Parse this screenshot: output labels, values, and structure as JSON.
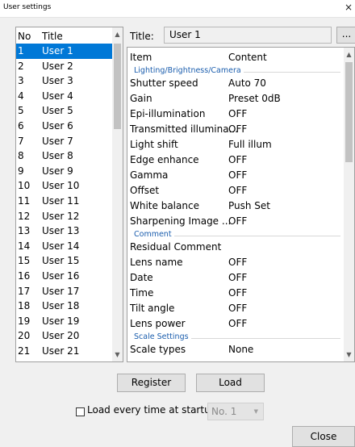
{
  "window": {
    "title": "User settings",
    "close_glyph": "×"
  },
  "list": {
    "col_no": "No",
    "col_title": "Title",
    "selected_index": 0,
    "items": [
      {
        "no": "1",
        "name": "User 1"
      },
      {
        "no": "2",
        "name": "User 2"
      },
      {
        "no": "3",
        "name": "User 3"
      },
      {
        "no": "4",
        "name": "User 4"
      },
      {
        "no": "5",
        "name": "User 5"
      },
      {
        "no": "6",
        "name": "User 6"
      },
      {
        "no": "7",
        "name": "User 7"
      },
      {
        "no": "8",
        "name": "User 8"
      },
      {
        "no": "9",
        "name": "User 9"
      },
      {
        "no": "10",
        "name": "User 10"
      },
      {
        "no": "11",
        "name": "User 11"
      },
      {
        "no": "12",
        "name": "User 12"
      },
      {
        "no": "13",
        "name": "User 13"
      },
      {
        "no": "14",
        "name": "User 14"
      },
      {
        "no": "15",
        "name": "User 15"
      },
      {
        "no": "16",
        "name": "User 16"
      },
      {
        "no": "17",
        "name": "User 17"
      },
      {
        "no": "18",
        "name": "User 18"
      },
      {
        "no": "19",
        "name": "User 19"
      },
      {
        "no": "20",
        "name": "User 20"
      },
      {
        "no": "21",
        "name": "User 21"
      }
    ]
  },
  "title_field": {
    "label": "Title:",
    "value": "User 1",
    "browse_label": "..."
  },
  "settings": {
    "col_item": "Item",
    "col_content": "Content",
    "rows": [
      {
        "group": "Lighting/Brightness/Camera"
      },
      {
        "item": "Shutter speed",
        "content": "Auto 70"
      },
      {
        "item": "Gain",
        "content": "Preset 0dB"
      },
      {
        "item": "Epi-illumination",
        "content": "OFF"
      },
      {
        "item": "Transmitted illumina...",
        "content": "OFF"
      },
      {
        "item": "Light shift",
        "content": "Full illum"
      },
      {
        "item": "Edge enhance",
        "content": "OFF"
      },
      {
        "item": "Gamma",
        "content": "OFF"
      },
      {
        "item": "Offset",
        "content": "OFF"
      },
      {
        "item": "White balance",
        "content": "Push Set"
      },
      {
        "item": "Sharpening Image ...",
        "content": "OFF"
      },
      {
        "group": "Comment"
      },
      {
        "item": "Residual Comment",
        "content": ""
      },
      {
        "item": "Lens name",
        "content": "OFF"
      },
      {
        "item": "Date",
        "content": "OFF"
      },
      {
        "item": "Time",
        "content": "OFF"
      },
      {
        "item": "Tilt angle",
        "content": "OFF"
      },
      {
        "item": "Lens power",
        "content": "OFF"
      },
      {
        "group": "Scale Settings"
      },
      {
        "item": "Scale types",
        "content": "None"
      }
    ]
  },
  "buttons": {
    "register": "Register",
    "load": "Load",
    "close": "Close"
  },
  "startup": {
    "checkbox_label": "Load every time at startup",
    "checked": false,
    "select_value": "No. 1"
  },
  "icons": {
    "scroll_up": "chevron-up-icon",
    "scroll_down": "chevron-down-icon",
    "dropdown": "chevron-down-icon"
  }
}
